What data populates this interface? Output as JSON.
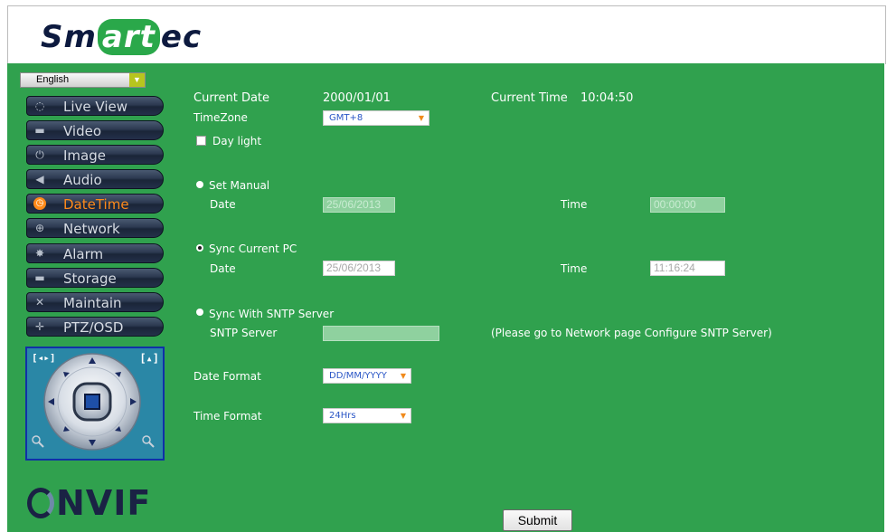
{
  "brand": {
    "logo_pre": "Sm",
    "logo_mid": "art",
    "logo_post": "ec"
  },
  "language": {
    "selected": "English"
  },
  "sidebar": {
    "items": [
      {
        "label": "Live View",
        "icon": "chat-bubble-icon",
        "glyph": "◌",
        "active": false
      },
      {
        "label": "Video",
        "icon": "camera-icon",
        "glyph": "▬",
        "active": false
      },
      {
        "label": "Image",
        "icon": "power-icon",
        "glyph": "⏻",
        "active": false
      },
      {
        "label": "Audio",
        "icon": "speaker-icon",
        "glyph": "◀",
        "active": false
      },
      {
        "label": "DateTime",
        "icon": "clock-icon",
        "glyph": "◷",
        "active": true
      },
      {
        "label": "Network",
        "icon": "globe-icon",
        "glyph": "⊕",
        "active": false
      },
      {
        "label": "Alarm",
        "icon": "alarm-icon",
        "glyph": "✸",
        "active": false
      },
      {
        "label": "Storage",
        "icon": "storage-icon",
        "glyph": "▬",
        "active": false
      },
      {
        "label": "Maintain",
        "icon": "wrench-icon",
        "glyph": "✕",
        "active": false
      },
      {
        "label": "PTZ/OSD",
        "icon": "ptz-icon",
        "glyph": "✛",
        "active": false
      }
    ]
  },
  "ptz": {
    "left_label": "[◂▸]",
    "right_label": "[▴]"
  },
  "onvif": {
    "text": "NVIF"
  },
  "form": {
    "current_date_label": "Current Date",
    "current_date_value": "2000/01/01",
    "current_time_label": "Current Time",
    "current_time_value": "10:04:50",
    "timezone_label": "TimeZone",
    "timezone_value": "GMT+8",
    "daylight_label": "Day light",
    "daylight_checked": false,
    "set_manual_label": "Set Manual",
    "manual_date_label": "Date",
    "manual_date_value": "25/06/2013",
    "manual_time_label": "Time",
    "manual_time_value": "00:00:00",
    "sync_pc_label": "Sync Current PC",
    "pc_date_label": "Date",
    "pc_date_value": "25/06/2013",
    "pc_time_label": "Time",
    "pc_time_value": "11:16:24",
    "sync_sntp_label": "Sync With SNTP Server",
    "sntp_server_label": "SNTP Server",
    "sntp_server_value": "",
    "sntp_note": "(Please go to Network page Configure SNTP Server)",
    "date_format_label": "Date Format",
    "date_format_value": "DD/MM/YYYY",
    "time_format_label": "Time Format",
    "time_format_value": "24Hrs",
    "mode_selected": "sync_pc",
    "submit_label": "Submit"
  },
  "colors": {
    "panel": "#30a14e",
    "accent": "#ff8a1a",
    "menu": "#24304a"
  }
}
